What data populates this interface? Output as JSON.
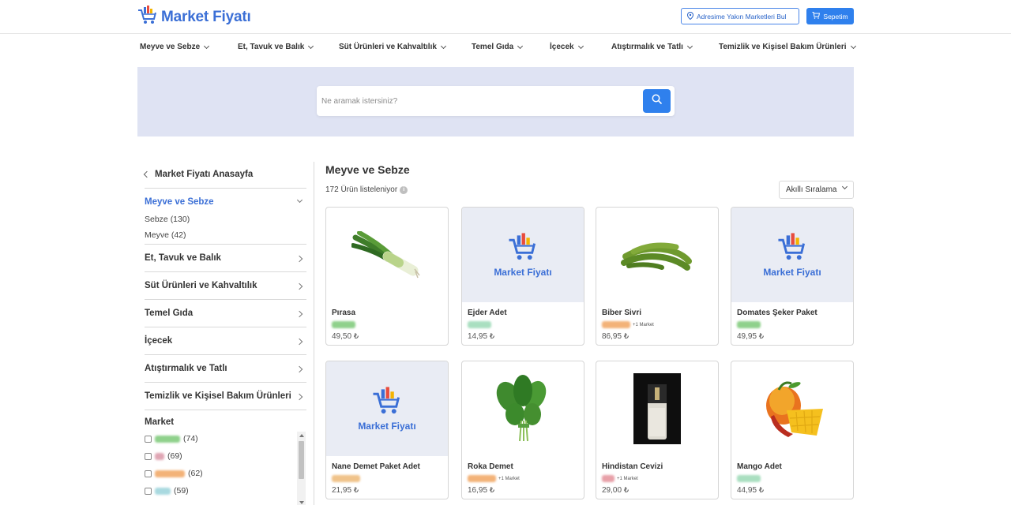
{
  "header": {
    "logo_text": "Market Fiyatı",
    "address_button": "Adresime Yakın Marketleri Bul",
    "cart_button": "Sepetim"
  },
  "categories": [
    "Meyve ve Sebze",
    "Et, Tavuk ve Balık",
    "Süt Ürünleri ve Kahvaltılık",
    "Temel Gıda",
    "İçecek",
    "Atıştırmalık ve Tatlı",
    "Temizlik ve Kişisel Bakım Ürünleri"
  ],
  "search": {
    "placeholder": "Ne aramak istersiniz?"
  },
  "sidebar": {
    "home_link": "Market Fiyatı Anasayfa",
    "active_category": "Meyve ve Sebze",
    "subcategories": [
      "Sebze (130)",
      "Meyve (42)"
    ],
    "other_categories": [
      "Et, Tavuk ve Balık",
      "Süt Ürünleri ve Kahvaltılık",
      "Temel Gıda",
      "İçecek",
      "Atıştırmalık ve Tatlı",
      "Temizlik ve Kişisel Bakım Ürünleri"
    ],
    "market_title": "Market",
    "markets": [
      {
        "count": "(74)",
        "color": "#8fd18b"
      },
      {
        "count": "(69)",
        "color": "#e0a6b4"
      },
      {
        "count": "(62)",
        "color": "#f3b278"
      },
      {
        "count": "(59)",
        "color": "#a9d9e0"
      }
    ]
  },
  "main": {
    "title": "Meyve ve Sebze",
    "result_count": "172 Ürün listeleniyor",
    "info_icon": "i",
    "sort_label": "Akıllı Sıralama",
    "placeholder_text": "Market Fiyatı",
    "products": [
      {
        "name": "Pırasa",
        "price": "49,50 ₺",
        "image": "leek",
        "market_color": "#8fd18b",
        "extra": ""
      },
      {
        "name": "Ejder Adet",
        "price": "14,95 ₺",
        "image": "placeholder",
        "market_color": "#a9dfc0",
        "extra": ""
      },
      {
        "name": "Biber Sivri",
        "price": "86,95 ₺",
        "image": "pepper",
        "market_color": "#f3b278",
        "extra": "+1 Market"
      },
      {
        "name": "Domates Şeker Paket",
        "price": "49,95 ₺",
        "image": "placeholder",
        "market_color": "#8fd18b",
        "extra": ""
      },
      {
        "name": "Nane Demet Paket Adet",
        "price": "21,95 ₺",
        "image": "placeholder",
        "market_color": "#f0c38a",
        "extra": ""
      },
      {
        "name": "Roka Demet",
        "price": "16,95 ₺",
        "image": "arugula",
        "market_color": "#f3b278",
        "extra": "+1 Market"
      },
      {
        "name": "Hindistan Cevizi",
        "price": "29,00 ₺",
        "image": "coconut",
        "market_color": "#e8a0a8",
        "extra": "+1 Market"
      },
      {
        "name": "Mango Adet",
        "price": "44,95 ₺",
        "image": "mango",
        "market_color": "#a9dfc0",
        "extra": ""
      }
    ]
  }
}
